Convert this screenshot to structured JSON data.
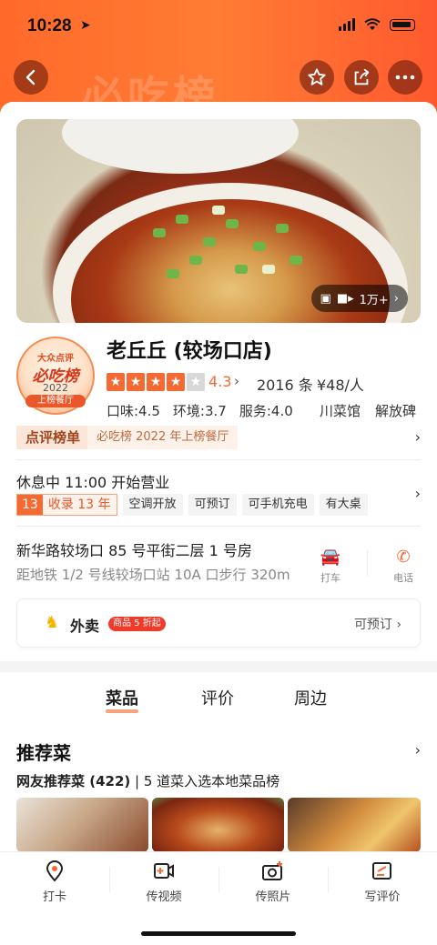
{
  "status": {
    "time": "10:28"
  },
  "header": {
    "watermark": "必吃榜"
  },
  "photo": {
    "count_label": "1万+"
  },
  "seal": {
    "brand": "大众点评",
    "title": "必吃榜",
    "year": "2022",
    "ribbon": "上榜餐厅"
  },
  "shop": {
    "name": "老丘丘 (较场口店)",
    "rating": "4.3",
    "stars": 4,
    "reviews": "2016 条",
    "price": "¥48/人",
    "taste": "口味:4.5",
    "env": "环境:3.7",
    "service": "服务:4.0",
    "category": "川菜馆",
    "area": "解放碑"
  },
  "list": {
    "tag": "点评榜单",
    "text": "必吃榜 2022 年上榜餐厅"
  },
  "hours": {
    "status": "休息中 11:00 开始营业",
    "years_num": "13",
    "years_text": "收录 13 年",
    "tags": [
      "空调开放",
      "可预订",
      "可手机充电",
      "有大桌"
    ]
  },
  "address": {
    "line": "新华路较场口 85 号平街二层 1 号房",
    "metro": "距地铁 1/2 号线较场口站 10A 口步行 320m",
    "taxi": "打车",
    "phone": "电话"
  },
  "delivery": {
    "label": "外卖",
    "promo": "商品 5 折起",
    "book": "可预订"
  },
  "tabs": [
    "菜品",
    "评价",
    "周边"
  ],
  "recommend": {
    "title": "推荐菜",
    "sub_bold": "网友推荐菜 (422)",
    "sub_rest": " | 5 道菜入选本地菜品榜"
  },
  "bottom": [
    "打卡",
    "传视频",
    "传照片",
    "写评价"
  ],
  "colors": {
    "accent": "#f46a32",
    "header": "#ff6a2a"
  }
}
